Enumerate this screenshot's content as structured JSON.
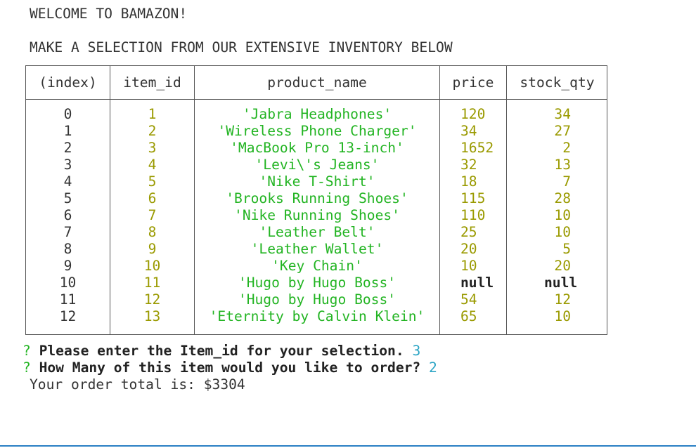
{
  "terminal": {
    "title": "WELCOME TO BAMAZON!",
    "subtitle": "MAKE A SELECTION FROM OUR EXTENSIVE INVENTORY BELOW"
  },
  "table": {
    "headers": [
      "(index)",
      "item_id",
      "product_name",
      "price",
      "stock_qty"
    ],
    "rows": [
      {
        "index": "0",
        "item_id": "1",
        "product_name": "'Jabra Headphones'",
        "price": "120",
        "stock_qty": "34"
      },
      {
        "index": "1",
        "item_id": "2",
        "product_name": "'Wireless Phone Charger'",
        "price": "34",
        "stock_qty": "27"
      },
      {
        "index": "2",
        "item_id": "3",
        "product_name": "'MacBook Pro 13-inch'",
        "price": "1652",
        "stock_qty": "2"
      },
      {
        "index": "3",
        "item_id": "4",
        "product_name": "'Levi\\'s Jeans'",
        "price": "32",
        "stock_qty": "13"
      },
      {
        "index": "4",
        "item_id": "5",
        "product_name": "'Nike T-Shirt'",
        "price": "18",
        "stock_qty": "7"
      },
      {
        "index": "5",
        "item_id": "6",
        "product_name": "'Brooks Running Shoes'",
        "price": "115",
        "stock_qty": "28"
      },
      {
        "index": "6",
        "item_id": "7",
        "product_name": "'Nike Running Shoes'",
        "price": "110",
        "stock_qty": "10"
      },
      {
        "index": "7",
        "item_id": "8",
        "product_name": "'Leather Belt'",
        "price": "25",
        "stock_qty": "10"
      },
      {
        "index": "8",
        "item_id": "9",
        "product_name": "'Leather Wallet'",
        "price": "20",
        "stock_qty": "5"
      },
      {
        "index": "9",
        "item_id": "10",
        "product_name": "'Key Chain'",
        "price": "10",
        "stock_qty": "20"
      },
      {
        "index": "10",
        "item_id": "11",
        "product_name": "'Hugo by Hugo Boss'",
        "price": "null",
        "stock_qty": "null"
      },
      {
        "index": "11",
        "item_id": "12",
        "product_name": "'Hugo by Hugo Boss'",
        "price": "54",
        "stock_qty": "12"
      },
      {
        "index": "12",
        "item_id": "13",
        "product_name": "'Eternity by Calvin Klein'",
        "price": "65",
        "stock_qty": "10"
      }
    ]
  },
  "prompts": [
    {
      "mark": "?",
      "question": "Please enter the Item_id for your selection.",
      "answer": "3"
    },
    {
      "mark": "?",
      "question": "How Many of this item would you like to order?",
      "answer": "2"
    }
  ],
  "result": "Your order total is: $3304",
  "colors": {
    "string": "#22b422",
    "number": "#9a9a00",
    "answer": "#2aa4c4",
    "border": "#555555"
  }
}
